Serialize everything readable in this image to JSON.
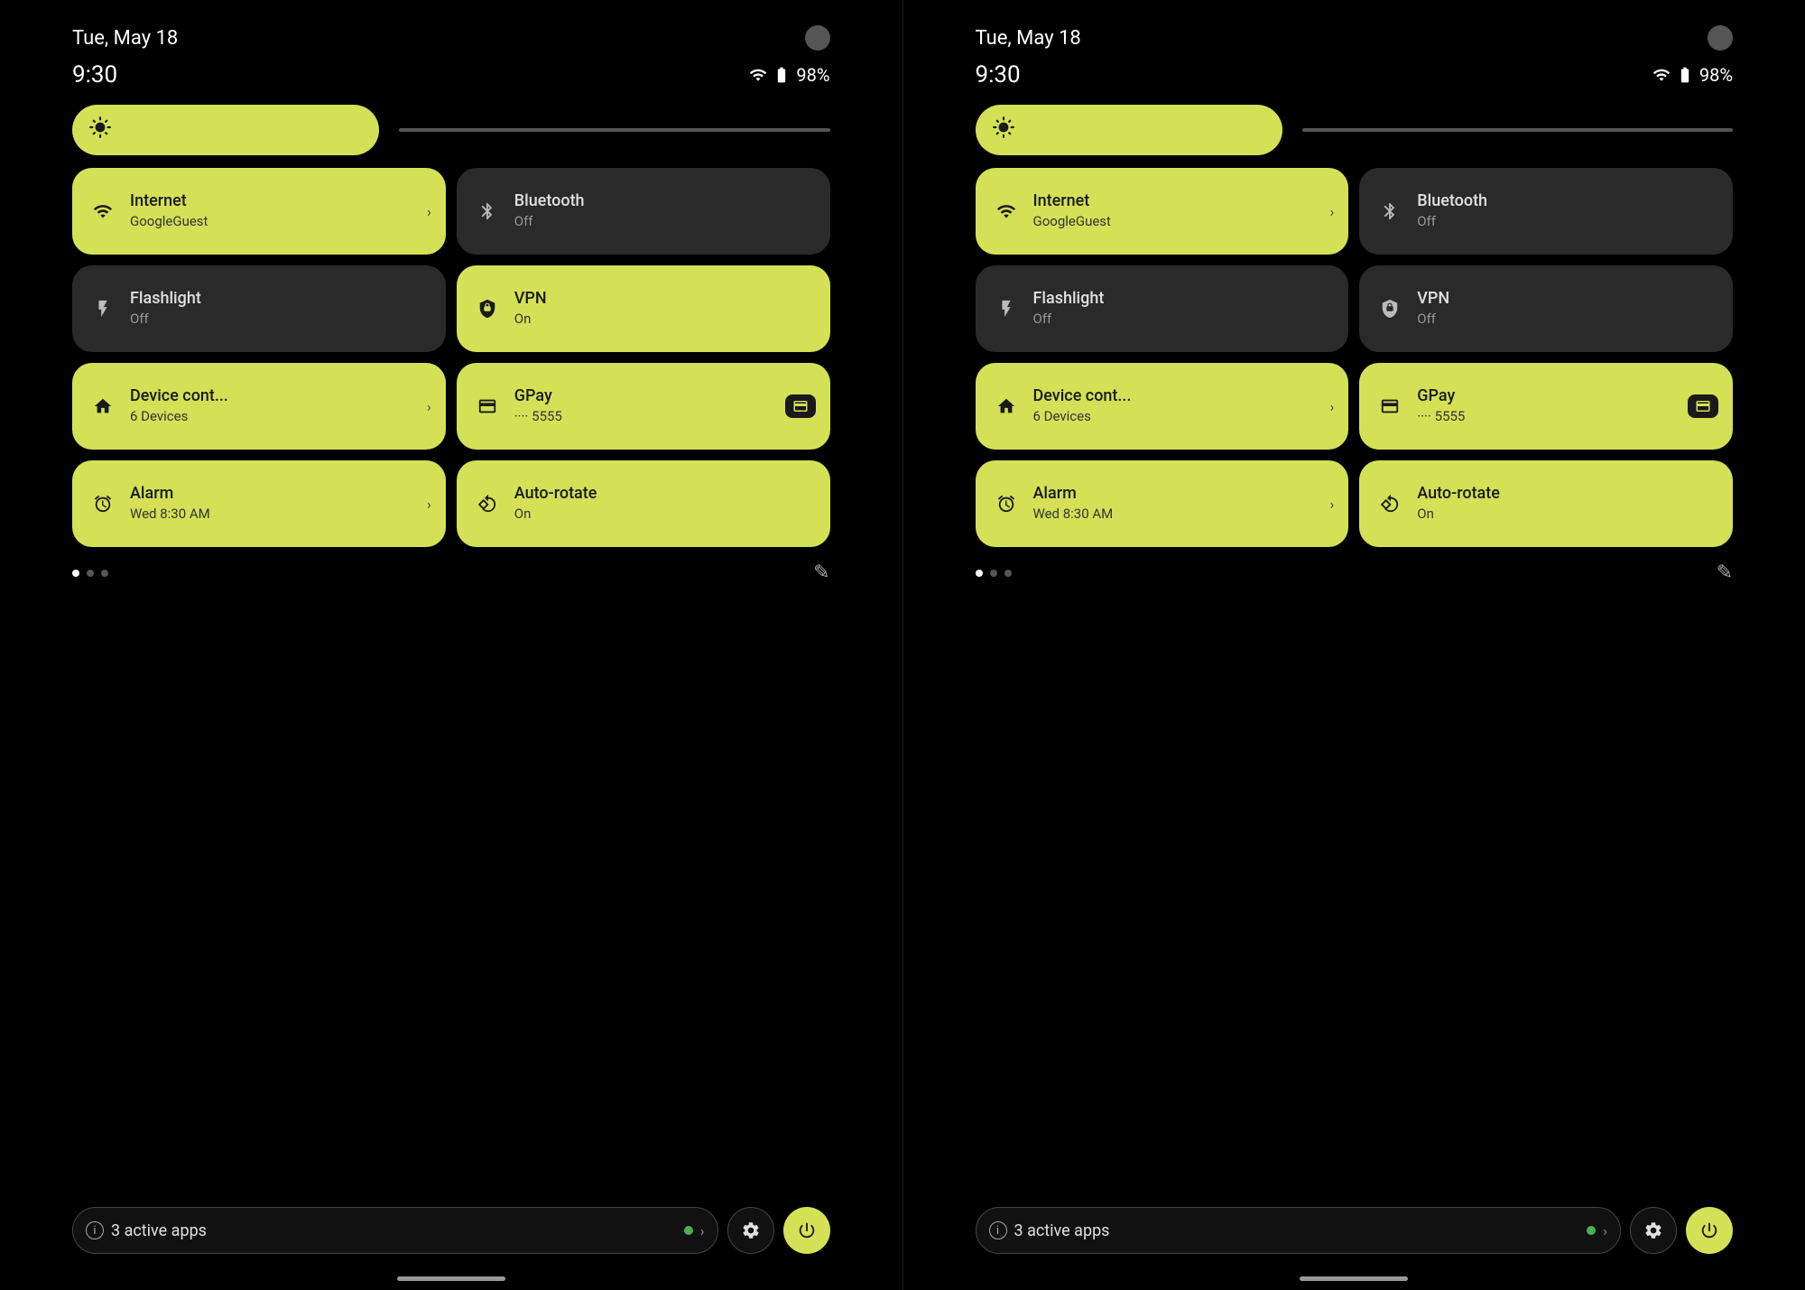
{
  "panels": [
    {
      "id": "left",
      "date": "Tue, May 18",
      "time": "9:30",
      "battery": "98%",
      "brightness_icon": "⚙",
      "tiles": [
        {
          "id": "internet",
          "icon": "wifi",
          "title": "Internet",
          "subtitle": "GoogleGuest",
          "active": true,
          "has_chevron": true,
          "gpay": false
        },
        {
          "id": "bluetooth",
          "icon": "bluetooth",
          "title": "Bluetooth",
          "subtitle": "Off",
          "active": false,
          "has_chevron": false,
          "gpay": false
        },
        {
          "id": "flashlight",
          "icon": "flashlight",
          "title": "Flashlight",
          "subtitle": "Off",
          "active": false,
          "has_chevron": false,
          "gpay": false
        },
        {
          "id": "vpn",
          "icon": "vpn",
          "title": "VPN",
          "subtitle": "On",
          "active": true,
          "has_chevron": false,
          "gpay": false
        },
        {
          "id": "device-control",
          "icon": "home",
          "title": "Device cont...",
          "subtitle": "6 Devices",
          "active": true,
          "has_chevron": true,
          "gpay": false
        },
        {
          "id": "gpay",
          "icon": "gpay",
          "title": "GPay",
          "subtitle": "···· 5555",
          "active": true,
          "has_chevron": false,
          "gpay": true
        },
        {
          "id": "alarm",
          "icon": "alarm",
          "title": "Alarm",
          "subtitle": "Wed 8:30 AM",
          "active": true,
          "has_chevron": true,
          "gpay": false
        },
        {
          "id": "auto-rotate",
          "icon": "rotate",
          "title": "Auto-rotate",
          "subtitle": "On",
          "active": true,
          "has_chevron": false,
          "gpay": false
        }
      ],
      "active_apps_label": "3 active apps",
      "edit_icon": "✎"
    },
    {
      "id": "right",
      "date": "Tue, May 18",
      "time": "9:30",
      "battery": "98%",
      "brightness_icon": "⚙",
      "tiles": [
        {
          "id": "internet",
          "icon": "wifi",
          "title": "Internet",
          "subtitle": "GoogleGuest",
          "active": true,
          "has_chevron": true,
          "gpay": false
        },
        {
          "id": "bluetooth",
          "icon": "bluetooth",
          "title": "Bluetooth",
          "subtitle": "Off",
          "active": false,
          "has_chevron": false,
          "gpay": false
        },
        {
          "id": "flashlight",
          "icon": "flashlight",
          "title": "Flashlight",
          "subtitle": "Off",
          "active": false,
          "has_chevron": false,
          "gpay": false
        },
        {
          "id": "vpn",
          "icon": "vpn",
          "title": "VPN",
          "subtitle": "Off",
          "active": false,
          "has_chevron": false,
          "gpay": false
        },
        {
          "id": "device-control",
          "icon": "home",
          "title": "Device cont...",
          "subtitle": "6 Devices",
          "active": true,
          "has_chevron": true,
          "gpay": false
        },
        {
          "id": "gpay",
          "icon": "gpay",
          "title": "GPay",
          "subtitle": "···· 5555",
          "active": true,
          "has_chevron": false,
          "gpay": true
        },
        {
          "id": "alarm",
          "icon": "alarm",
          "title": "Alarm",
          "subtitle": "Wed 8:30 AM",
          "active": true,
          "has_chevron": true,
          "gpay": false
        },
        {
          "id": "auto-rotate",
          "icon": "rotate",
          "title": "Auto-rotate",
          "subtitle": "On",
          "active": true,
          "has_chevron": false,
          "gpay": false
        }
      ],
      "active_apps_label": "3 active apps",
      "edit_icon": "✎"
    }
  ],
  "icons": {
    "wifi": "▲",
    "bluetooth": "✦",
    "flashlight": "🔦",
    "vpn": "⊕",
    "home": "⌂",
    "gpay": "💳",
    "alarm": "⏰",
    "rotate": "↻",
    "settings": "⚙",
    "power": "⏻",
    "info": "i",
    "edit": "✎",
    "chevron_right": "›",
    "battery": "🔋",
    "wifi_status": "▲"
  },
  "colors": {
    "active_tile": "#d4e157",
    "inactive_tile": "#2a2a2a",
    "background": "#000000",
    "active_text": "#1a1a1a",
    "inactive_text": "#e0e0e0",
    "inactive_subtext": "#999999"
  }
}
